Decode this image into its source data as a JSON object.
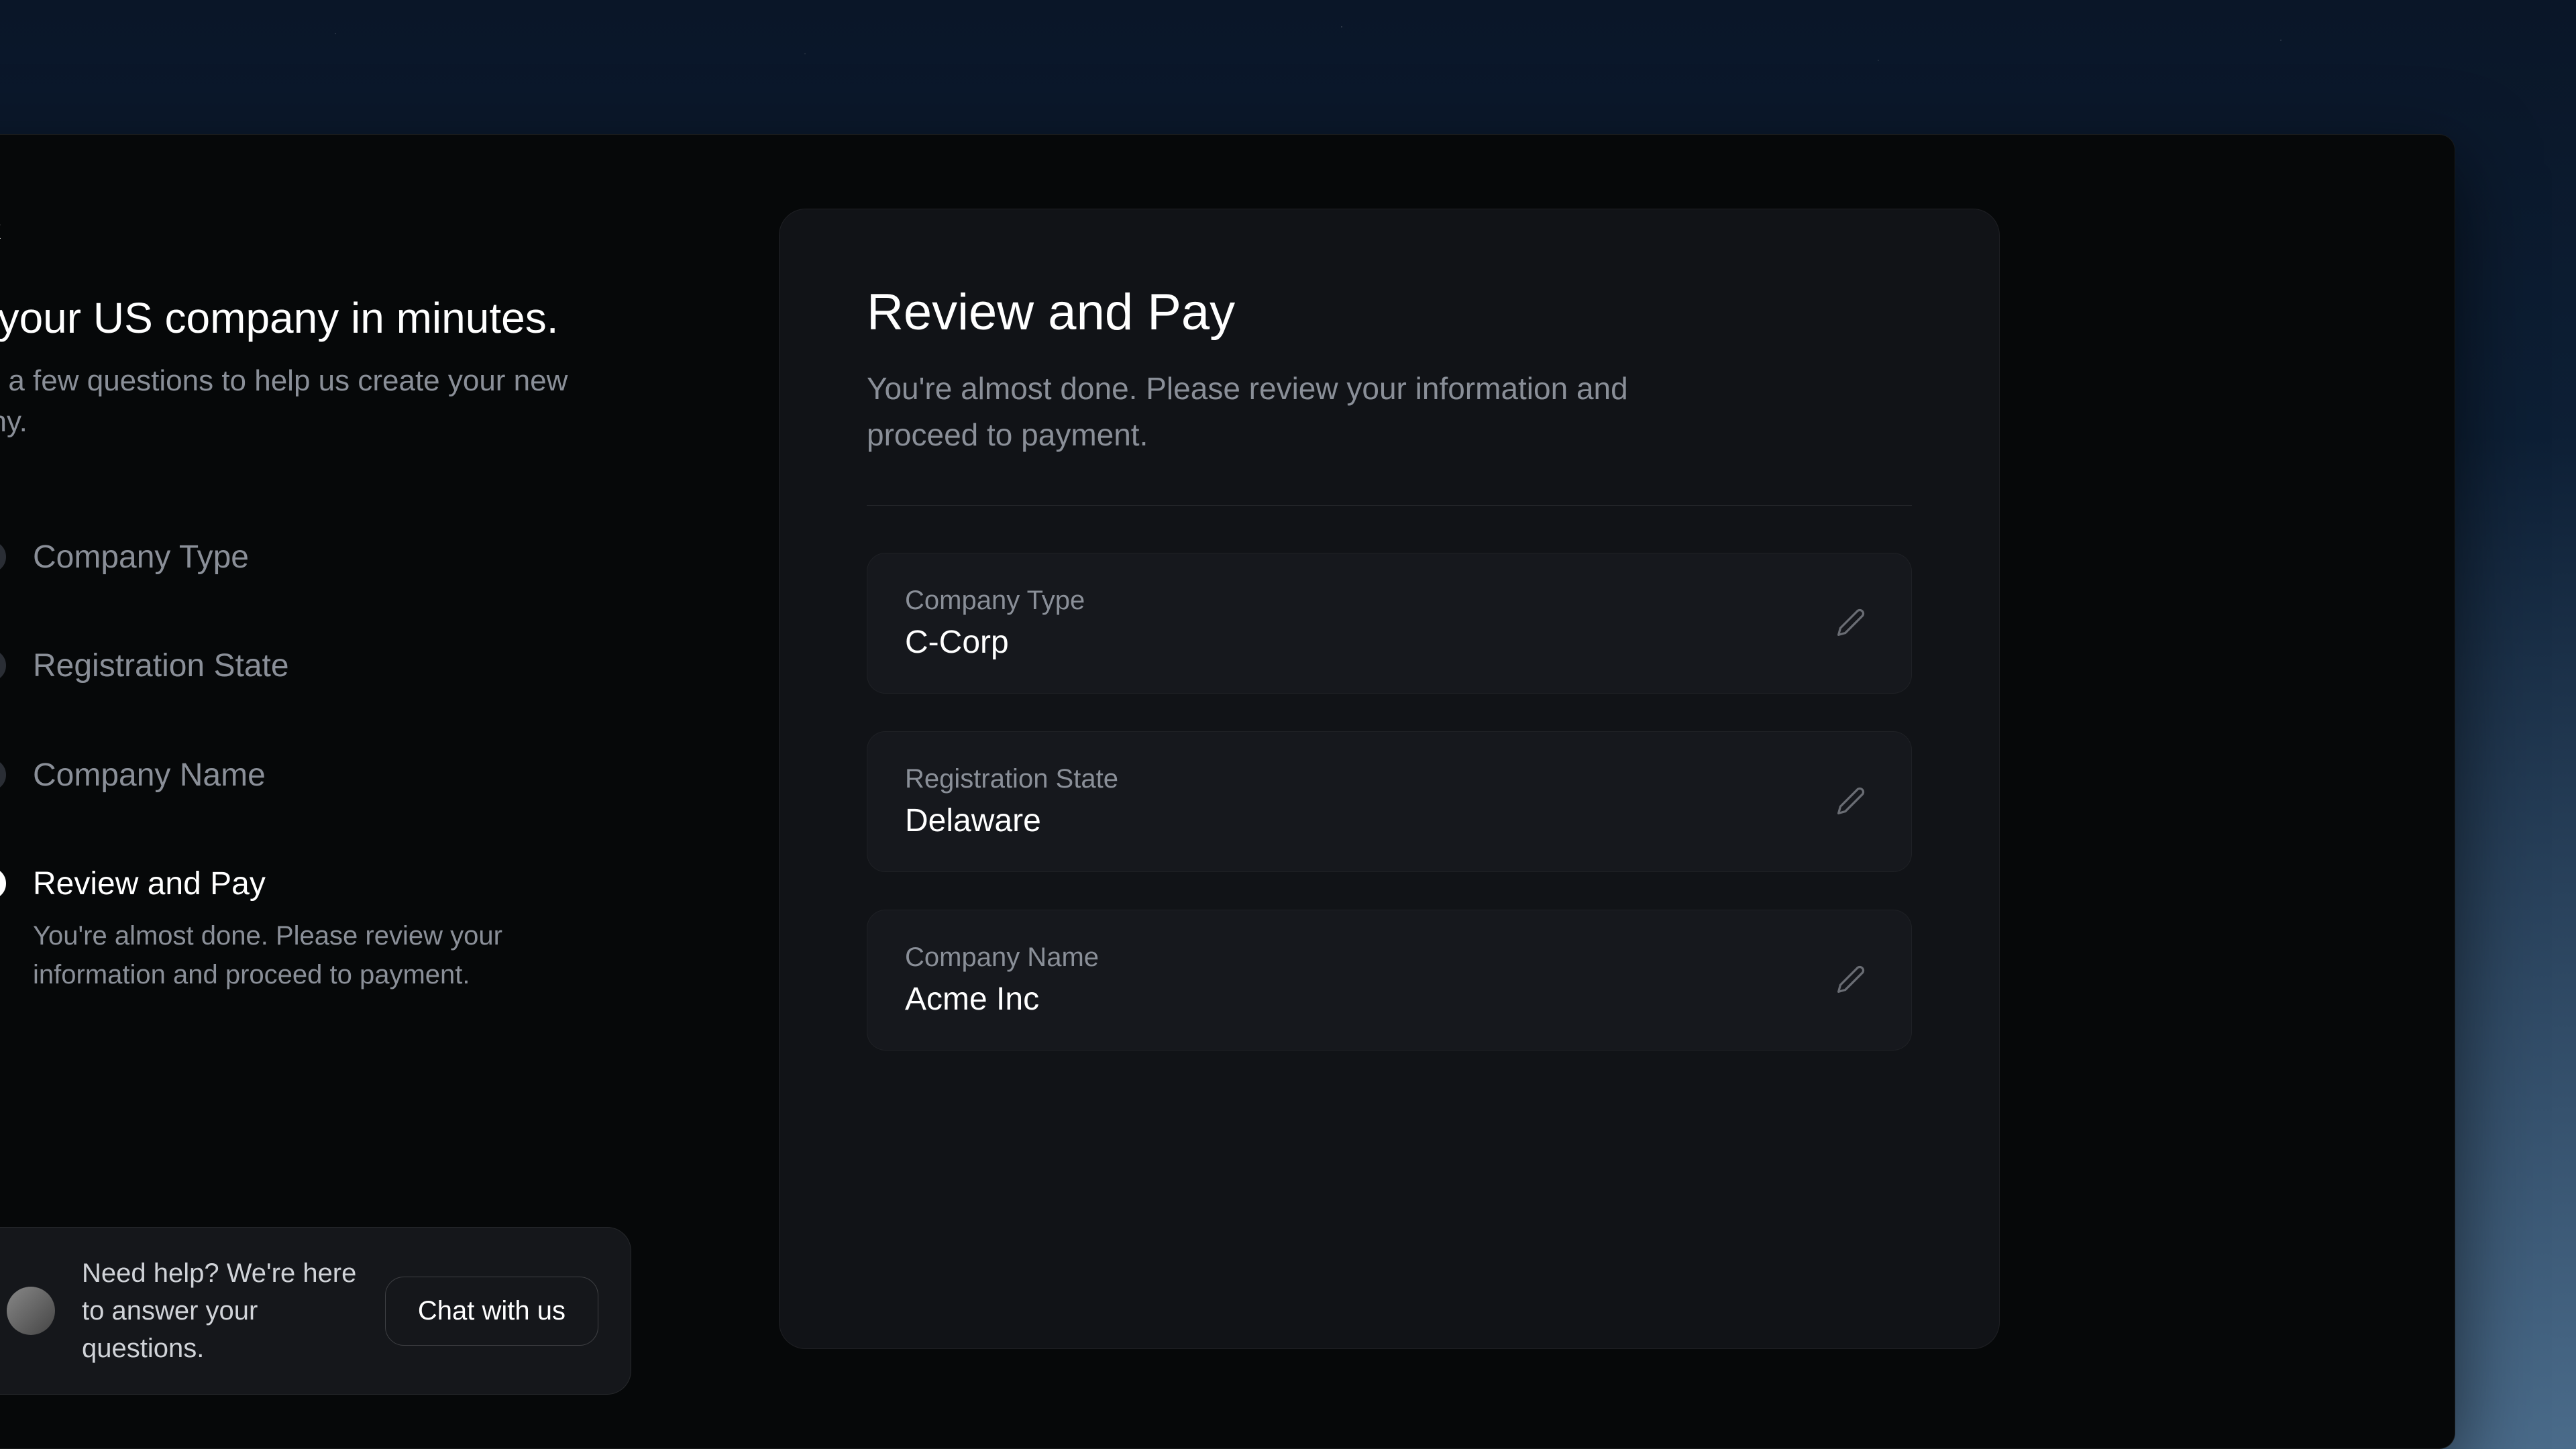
{
  "sidebar": {
    "back_label": "ck",
    "headline": "t your US company in minutes.",
    "subheadline": "er a few questions to help us create your new any.",
    "steps": [
      {
        "label": "Company Type",
        "state": "completed"
      },
      {
        "label": "Registration State",
        "state": "completed"
      },
      {
        "label": "Company Name",
        "state": "completed"
      },
      {
        "label": "Review and Pay",
        "state": "active",
        "description": "You're almost done. Please review your information and proceed to payment."
      }
    ]
  },
  "help": {
    "text": "Need help? We're here to answer your questions.",
    "button": "Chat with us"
  },
  "review": {
    "title": "Review and Pay",
    "subtitle": "You're almost done. Please review your information and proceed to payment.",
    "items": [
      {
        "label": "Company Type",
        "value": "C-Corp"
      },
      {
        "label": "Registration State",
        "value": "Delaware"
      },
      {
        "label": "Company Name",
        "value": "Acme Inc"
      }
    ]
  }
}
